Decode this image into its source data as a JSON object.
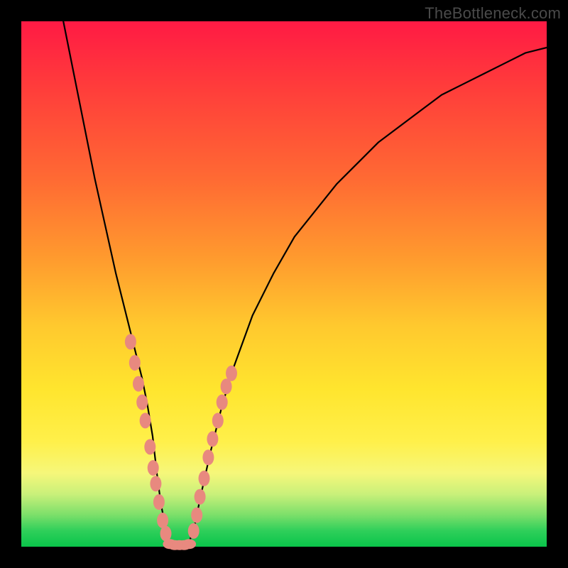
{
  "watermark": "TheBottleneck.com",
  "chart_data": {
    "type": "line",
    "title": "",
    "xlabel": "",
    "ylabel": "",
    "xlim": [
      0,
      100
    ],
    "ylim": [
      0,
      100
    ],
    "grid": false,
    "legend": false,
    "series": [
      {
        "name": "curve",
        "x": [
          8,
          10,
          12,
          14,
          16,
          18,
          20,
          22,
          23,
          24,
          25,
          25.8,
          26.6,
          27.4,
          28,
          29,
          30,
          31,
          32,
          33,
          34,
          36,
          38,
          40,
          44,
          48,
          52,
          56,
          60,
          64,
          68,
          72,
          76,
          80,
          84,
          88,
          92,
          96,
          100
        ],
        "y": [
          100,
          90,
          80,
          70,
          61,
          52,
          44,
          36,
          32,
          27,
          21,
          14,
          8,
          4,
          1,
          0,
          0,
          0,
          1,
          4,
          9,
          18,
          26,
          33,
          44,
          52,
          59,
          64,
          69,
          73,
          77,
          80,
          83,
          86,
          88,
          90,
          92,
          94,
          95
        ]
      }
    ],
    "markers_left": {
      "comment": "salmon elliptical markers scattered on descending arm",
      "points": [
        {
          "x": 20.8,
          "y": 39
        },
        {
          "x": 21.6,
          "y": 35
        },
        {
          "x": 22.3,
          "y": 31
        },
        {
          "x": 23.0,
          "y": 27.5
        },
        {
          "x": 23.6,
          "y": 24
        },
        {
          "x": 24.5,
          "y": 19
        },
        {
          "x": 25.1,
          "y": 15
        },
        {
          "x": 25.6,
          "y": 12
        },
        {
          "x": 26.2,
          "y": 8.5
        },
        {
          "x": 26.9,
          "y": 5
        },
        {
          "x": 27.5,
          "y": 2.5
        }
      ]
    },
    "markers_right": {
      "comment": "salmon elliptical markers scattered on ascending arm",
      "points": [
        {
          "x": 32.8,
          "y": 3
        },
        {
          "x": 33.4,
          "y": 6
        },
        {
          "x": 34.0,
          "y": 9.5
        },
        {
          "x": 34.8,
          "y": 13
        },
        {
          "x": 35.6,
          "y": 17
        },
        {
          "x": 36.4,
          "y": 20.5
        },
        {
          "x": 37.4,
          "y": 24
        },
        {
          "x": 38.2,
          "y": 27.5
        },
        {
          "x": 39.0,
          "y": 30.5
        },
        {
          "x": 40.0,
          "y": 33
        }
      ]
    },
    "markers_bottom": {
      "comment": "flat cluster of salmon markers at curve minimum",
      "points": [
        {
          "x": 28.3,
          "y": 0.5
        },
        {
          "x": 29.2,
          "y": 0.3
        },
        {
          "x": 30.1,
          "y": 0.3
        },
        {
          "x": 31.0,
          "y": 0.3
        },
        {
          "x": 31.9,
          "y": 0.5
        }
      ]
    },
    "marker_color": "#e8897f"
  }
}
